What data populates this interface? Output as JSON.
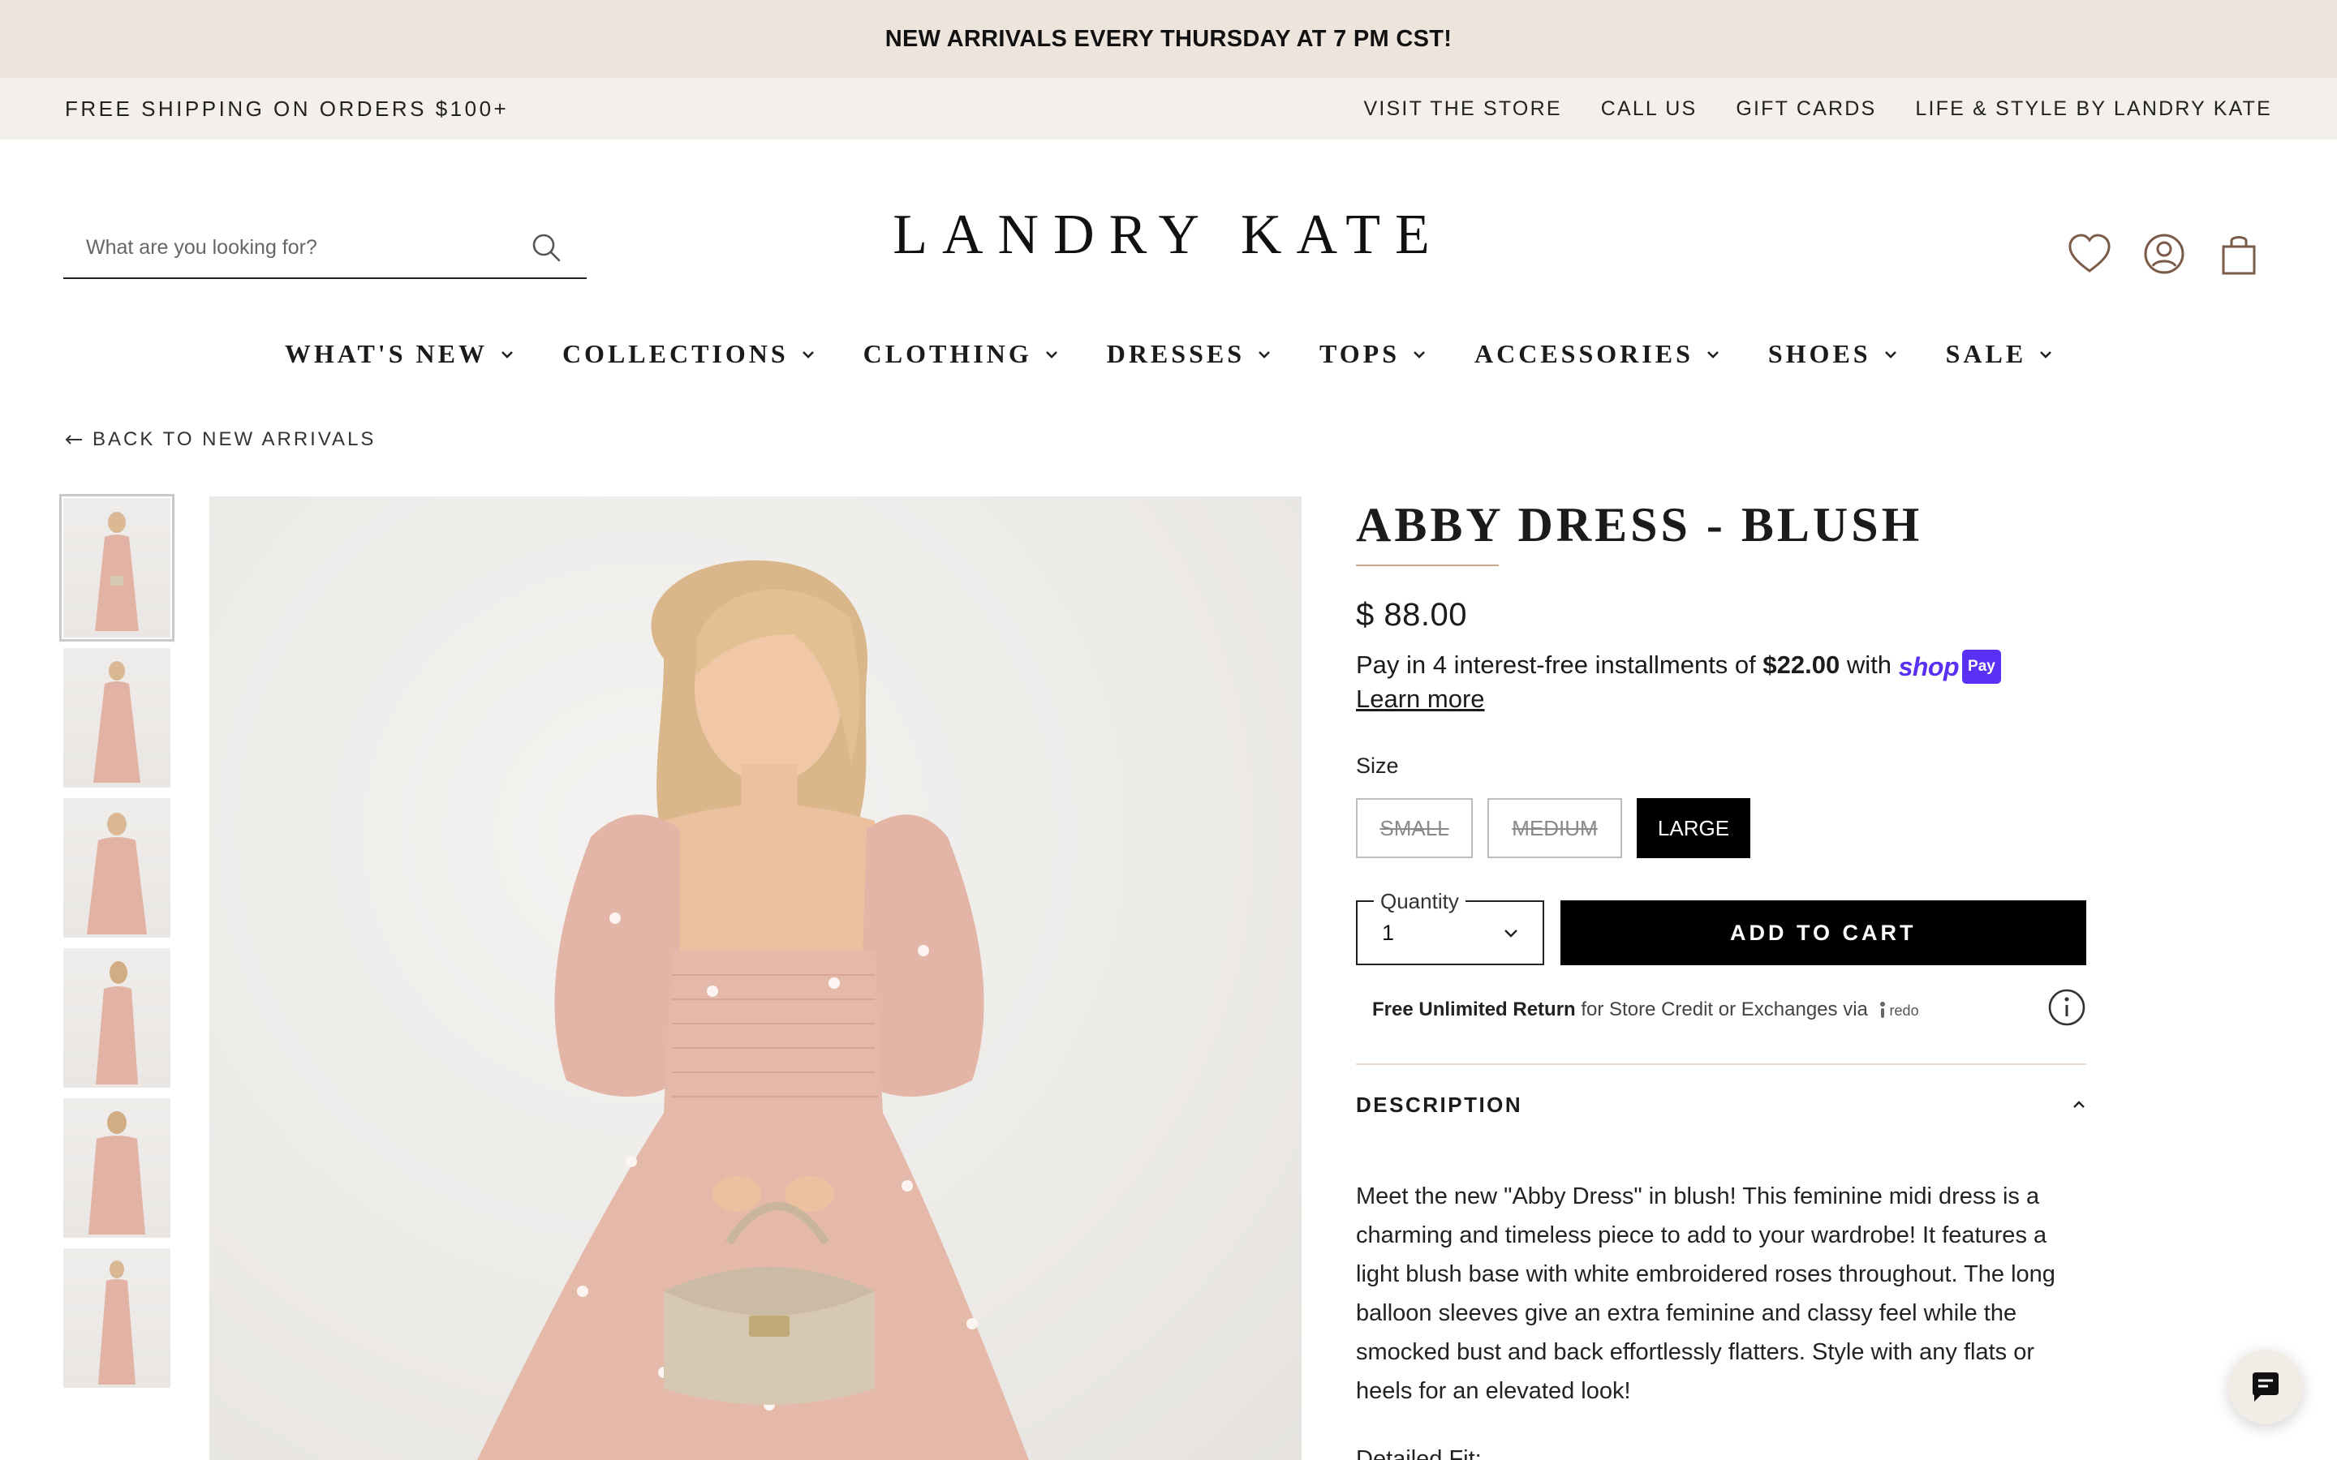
{
  "announcement": {
    "text": "NEW ARRIVALS EVERY THURSDAY AT 7 PM CST!"
  },
  "utility_bar": {
    "shipping_text": "FREE SHIPPING ON ORDERS $100+",
    "links": [
      "VISIT THE STORE",
      "CALL US",
      "GIFT CARDS",
      "LIFE & STYLE BY LANDRY KATE"
    ]
  },
  "header": {
    "search_placeholder": "What are you looking for?",
    "logo": "LANDRY KATE",
    "icons": [
      "heart-icon",
      "account-icon",
      "shopping-bag-icon"
    ]
  },
  "nav": {
    "items": [
      "WHAT'S NEW",
      "COLLECTIONS",
      "CLOTHING",
      "DRESSES",
      "TOPS",
      "ACCESSORIES",
      "SHOES",
      "SALE"
    ]
  },
  "back_link": {
    "label": "BACK TO NEW ARRIVALS"
  },
  "product": {
    "title": "ABBY DRESS - BLUSH",
    "price": "$ 88.00",
    "installments": {
      "prefix": "Pay in 4 interest-free installments of ",
      "amount": "$22.00",
      "suffix": " with ",
      "shop_word": "shop",
      "pay_word": "Pay",
      "learn_more": "Learn more"
    },
    "size_label": "Size",
    "sizes": [
      {
        "label": "SMALL",
        "available": false,
        "selected": false
      },
      {
        "label": "MEDIUM",
        "available": false,
        "selected": false
      },
      {
        "label": "LARGE",
        "available": true,
        "selected": true
      }
    ],
    "quantity_label": "Quantity",
    "quantity_value": "1",
    "add_to_cart": "ADD TO CART",
    "returns": {
      "bold": "Free Unlimited Return",
      "rest": " for Store Credit or Exchanges via",
      "brand": "redo"
    },
    "description_heading": "DESCRIPTION",
    "description": "Meet the new \"Abby Dress\" in blush! This feminine midi dress is a charming and timeless piece to add to your wardrobe! It features a light blush base with white embroidered roses throughout. The long balloon sleeves give an extra feminine and classy feel while the smocked bust and back effortlessly flatters. Style with any flats or heels for an elevated look!",
    "detailed_fit": "Detailed Fit:"
  },
  "colors": {
    "announcement_bg": "#ede4dc",
    "utility_bg": "#f3efeb",
    "accent_rule": "#c7a98c",
    "shop_pay": "#5a31f4",
    "dress_blush": "#e2b3a5"
  }
}
